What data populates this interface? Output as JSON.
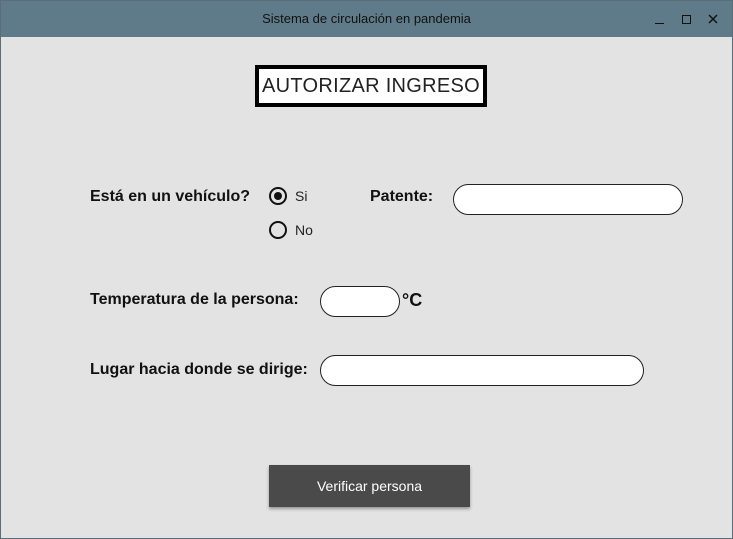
{
  "window": {
    "title": "Sistema de circulación en pandemia",
    "controls": [
      "minimize",
      "maximize",
      "close"
    ]
  },
  "heading": "AUTORIZAR INGRESO",
  "form": {
    "vehicle_question": "Está en un vehículo?",
    "vehicle_options": [
      {
        "label": "Si",
        "selected": true
      },
      {
        "label": "No",
        "selected": false
      }
    ],
    "patente_label": "Patente:",
    "patente_value": "",
    "temperature_label": "Temperatura de la persona:",
    "temperature_value": "",
    "temperature_unit": "°C",
    "destination_label": "Lugar hacia donde se dirige:",
    "destination_value": ""
  },
  "verify_button": "Verificar persona",
  "colors": {
    "titlebar": "#5f7b89",
    "background": "#e3e3e3",
    "button": "#4a4a4a"
  }
}
